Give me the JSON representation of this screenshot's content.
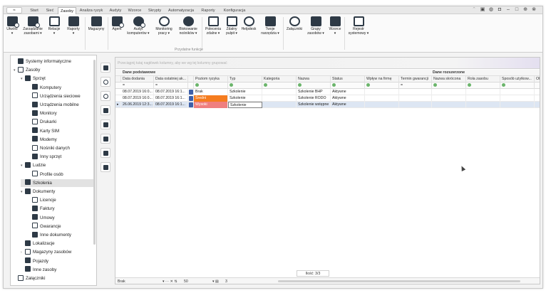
{
  "menu": {
    "app_button": "≈",
    "tabs": [
      "Start",
      "Sieć",
      "Zasoby",
      "Analiza ryzyk",
      "Audyty",
      "Wzorce",
      "Skrypty",
      "Automatyzacja",
      "Raporty",
      "Konfiguracja"
    ],
    "active_tab": "Zasoby"
  },
  "ribbon": {
    "buttons": [
      {
        "label1": "Utwórz",
        "label2": "▾",
        "icon": "create-icon"
      },
      {
        "label1": "Zarządzanie",
        "label2": "zasobami ▾",
        "icon": "manage-assets-icon"
      },
      {
        "label1": "Relacje",
        "label2": "▾",
        "icon": "relations-icon"
      },
      {
        "label1": "Raporty",
        "label2": "▾",
        "icon": "reports-icon"
      },
      {
        "label1": "Magazyny",
        "label2": "",
        "icon": "warehouse-icon"
      },
      {
        "label1": "Agent",
        "label2": "",
        "icon": "agent-icon"
      },
      {
        "label1": "Audyt",
        "label2": "komputerów ▾",
        "icon": "audit-icon"
      },
      {
        "label1": "Monitoring",
        "label2": "pracy ▾",
        "icon": "monitoring-icon"
      },
      {
        "label1": "Blokowanie",
        "label2": "nośników ▾",
        "icon": "blocking-icon"
      },
      {
        "label1": "Polecenia",
        "label2": "zdalne ▾",
        "icon": "remote-commands-icon"
      },
      {
        "label1": "Zdalny",
        "label2": "pulpit ▾",
        "icon": "remote-desktop-icon"
      },
      {
        "label1": "Helpdesk",
        "label2": "",
        "icon": "helpdesk-icon"
      },
      {
        "label1": "Twoje",
        "label2": "narzędzia ▾",
        "icon": "tools-icon"
      },
      {
        "label1": "Załączniki",
        "label2": "",
        "icon": "attachments-icon"
      },
      {
        "label1": "Grupy",
        "label2": "zasobów ▾",
        "icon": "groups-icon"
      },
      {
        "label1": "Wzorce",
        "label2": "▾",
        "icon": "patterns-icon"
      },
      {
        "label1": "Rejestr",
        "label2": "systemowy ▾",
        "icon": "registry-icon"
      }
    ],
    "group_label": "Przydatne funkcje"
  },
  "tree": {
    "items": [
      {
        "label": "Systemy informatyczne",
        "level": 0,
        "exp": ""
      },
      {
        "label": "Zasoby",
        "level": 0,
        "exp": "▾"
      },
      {
        "label": "Sprzęt",
        "level": 1,
        "exp": "▾"
      },
      {
        "label": "Komputery",
        "level": 2,
        "exp": ""
      },
      {
        "label": "Urządzenia sieciowe",
        "level": 2,
        "exp": ""
      },
      {
        "label": "Urządzenia mobilne",
        "level": 2,
        "exp": ""
      },
      {
        "label": "Monitory",
        "level": 2,
        "exp": ""
      },
      {
        "label": "Drukarki",
        "level": 2,
        "exp": ""
      },
      {
        "label": "Karty SIM",
        "level": 2,
        "exp": ""
      },
      {
        "label": "Modemy",
        "level": 2,
        "exp": ""
      },
      {
        "label": "Nośniki danych",
        "level": 2,
        "exp": ""
      },
      {
        "label": "Inny sprzęt",
        "level": 2,
        "exp": ""
      },
      {
        "label": "Ludzie",
        "level": 1,
        "exp": "▾"
      },
      {
        "label": "Profile osób",
        "level": 2,
        "exp": ""
      },
      {
        "label": "Szkolenia",
        "level": 1,
        "exp": "",
        "selected": true
      },
      {
        "label": "Dokumenty",
        "level": 1,
        "exp": "▾"
      },
      {
        "label": "Licencje",
        "level": 2,
        "exp": ""
      },
      {
        "label": "Faktury",
        "level": 2,
        "exp": ""
      },
      {
        "label": "Umowy",
        "level": 2,
        "exp": ""
      },
      {
        "label": "Gwarancje",
        "level": 2,
        "exp": ""
      },
      {
        "label": "Inne dokumenty",
        "level": 2,
        "exp": ""
      },
      {
        "label": "Lokalizacje",
        "level": 1,
        "exp": ""
      },
      {
        "label": "Magazyny zasobów",
        "level": 1,
        "exp": "›"
      },
      {
        "label": "Pojazdy",
        "level": 1,
        "exp": ""
      },
      {
        "label": "Inne zasoby",
        "level": 1,
        "exp": ""
      },
      {
        "label": "Załączniki",
        "level": 0,
        "exp": ""
      }
    ]
  },
  "grid": {
    "group_hint": "Przeciągnij tutaj nagłówek kolumny, aby we wg tej kolumny grupować",
    "bands": [
      "Dane podstawowe",
      "Dane rozszerzone"
    ],
    "columns": [
      "Data dodania",
      "Data ostatniej ak...",
      "",
      "Poziom ryzyka",
      "Typ",
      "Kategoria",
      "Nazwa",
      "Status",
      "Wpływ na firmę",
      "Termin gwarancji",
      "Nazwa skrócona",
      "Rola zasobu",
      "Sposób użytkow...",
      "Okre"
    ],
    "filter_symbols": [
      "=",
      "=",
      "",
      "⊕",
      "⊕",
      "⊕",
      "⊕",
      "⊕",
      "⊕",
      "=",
      "⊕",
      "⊕",
      "⊕",
      ""
    ],
    "rows": [
      {
        "added": "08.07.2019 16:0...",
        "last": "08.07.2019 16:1...",
        "risk": "Brak",
        "risk_color": "#ffffff",
        "type": "Szkolenie",
        "category": "",
        "name": "Szkolenie BHP",
        "status": "Aktywne"
      },
      {
        "added": "08.07.2019 16:0...",
        "last": "08.07.2019 16:1...",
        "risk": "Średni",
        "risk_color": "#f57c1f",
        "type": "Szkolenie",
        "category": "",
        "name": "Szkolenie RODO",
        "status": "Aktywne"
      },
      {
        "added": "26.06.2019 12:3...",
        "last": "08.07.2019 16:1...",
        "risk": "Wysoki",
        "risk_color": "#ef7f7f",
        "type": "Szkolenie",
        "category": "",
        "name": "Szkolenie wstępne",
        "status": "Aktywne",
        "current": true
      }
    ],
    "count_label": "Ilość: 3/3",
    "footer": {
      "filter_value": "Brak",
      "zoom": "50",
      "page": "3"
    }
  }
}
